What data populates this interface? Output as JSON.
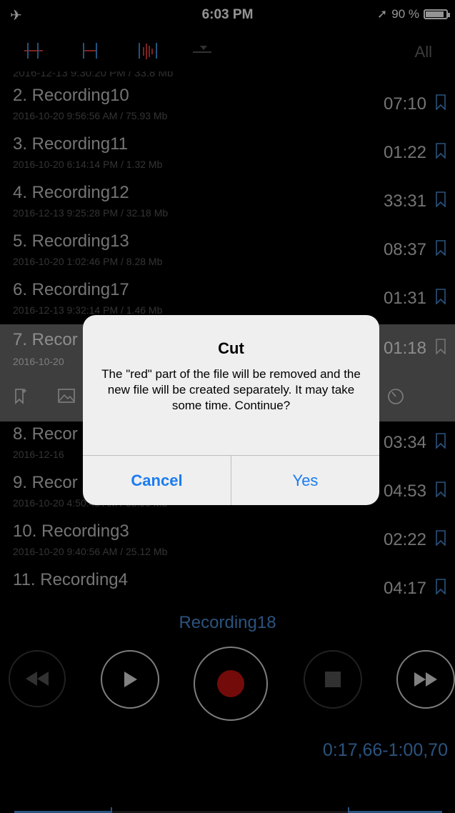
{
  "status_bar": {
    "time": "6:03 PM",
    "battery": "90 %"
  },
  "toolbar": {
    "all_label": "All"
  },
  "partial_top_meta": "2016-12-13 9:30:20 PM / 33.8 Mb",
  "recordings": [
    {
      "title": "2. Recording10",
      "meta": "2016-10-20 9:56:56 AM / 75.93 Mb",
      "duration": "07:10"
    },
    {
      "title": "3. Recording11",
      "meta": "2016-10-20 6:14:14 PM / 1.32 Mb",
      "duration": "01:22"
    },
    {
      "title": "4. Recording12",
      "meta": "2016-12-13 9:25:28 PM / 32.18 Mb",
      "duration": "33:31"
    },
    {
      "title": "5. Recording13",
      "meta": "2016-10-20 1:02:46 PM / 8.28 Mb",
      "duration": "08:37"
    },
    {
      "title": "6. Recording17",
      "meta": "2016-12-13 9:32:14 PM / 1.46 Mb",
      "duration": "01:31"
    },
    {
      "title": "7. Recor",
      "meta": "2016-10-20",
      "duration": "01:18"
    },
    {
      "title": "8. Recor",
      "meta": "2016-12-16",
      "duration": "03:34"
    },
    {
      "title": "9. Recor",
      "meta": "2016-10-20 4:50:48 AM / 33.50 Mb",
      "duration": "04:53"
    },
    {
      "title": "10. Recording3",
      "meta": "2016-10-20 9:40:56 AM / 25.12 Mb",
      "duration": "02:22"
    },
    {
      "title": "11. Recording4",
      "meta": "",
      "duration": "04:17"
    }
  ],
  "player": {
    "now_playing": "Recording18",
    "range": "0:17,66-1:00,70"
  },
  "dialog": {
    "title": "Cut",
    "message": "The \"red\" part of the file will be removed and the new file will be created separately. It may take some time. Continue?",
    "cancel_label": "Cancel",
    "yes_label": "Yes"
  },
  "colors": {
    "accent": "#4a90d9",
    "record": "#c81414",
    "dialog_button": "#1a7cf2"
  }
}
